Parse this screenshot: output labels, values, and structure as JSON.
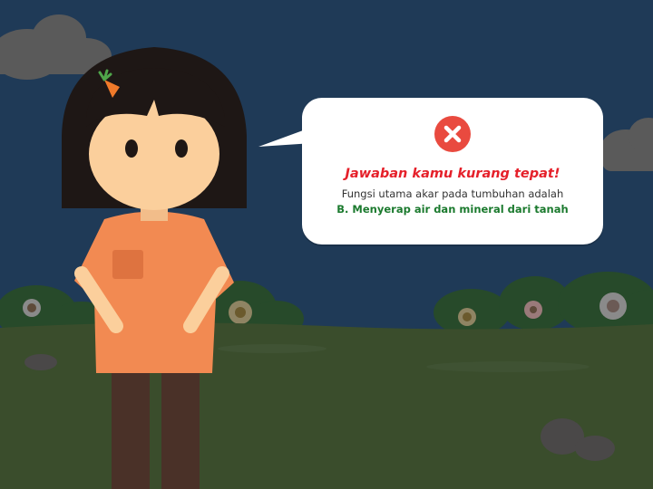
{
  "feedback": {
    "status_icon": "close-x-icon",
    "title": "Jawaban kamu kurang tepat!",
    "message": "Fungsi utama akar pada tumbuhan adalah",
    "answer": "B. Menyerap air dan mineral dari tanah"
  },
  "colors": {
    "sky": "#1f3a57",
    "grass": "#3a4d2c",
    "bubble": "#ffffff",
    "error_red": "#e94a3f",
    "title_red": "#e5202a",
    "answer_green": "#1b7a2e",
    "shirt": "#f28a52",
    "hair": "#1e1715",
    "skin": "#fbcf9c",
    "pants": "#4a3128"
  }
}
